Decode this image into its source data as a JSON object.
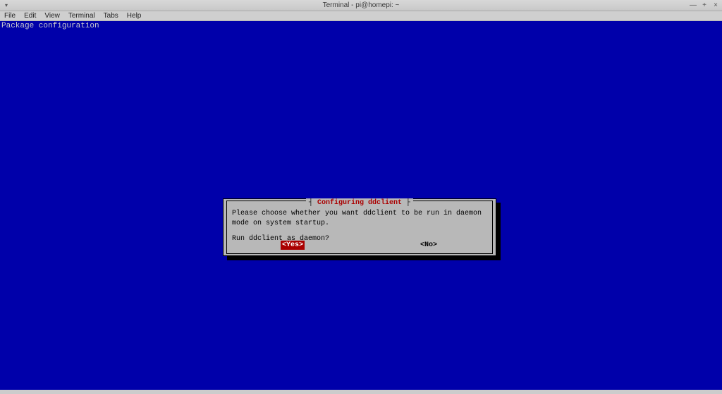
{
  "window": {
    "title": "Terminal - pi@homepi: ~",
    "controls": {
      "minimize": "—",
      "maximize": "+",
      "close": "×"
    },
    "dropdown_glyph": "▾"
  },
  "menu": {
    "items": [
      "File",
      "Edit",
      "View",
      "Terminal",
      "Tabs",
      "Help"
    ]
  },
  "terminal": {
    "header": "Package configuration"
  },
  "dialog": {
    "title": "Configuring ddclient",
    "message": "Please choose whether you want ddclient to be run in daemon mode on system startup.",
    "question": "Run ddclient as daemon?",
    "buttons": {
      "yes": "<Yes>",
      "no": "<No>"
    },
    "selected": "yes"
  }
}
